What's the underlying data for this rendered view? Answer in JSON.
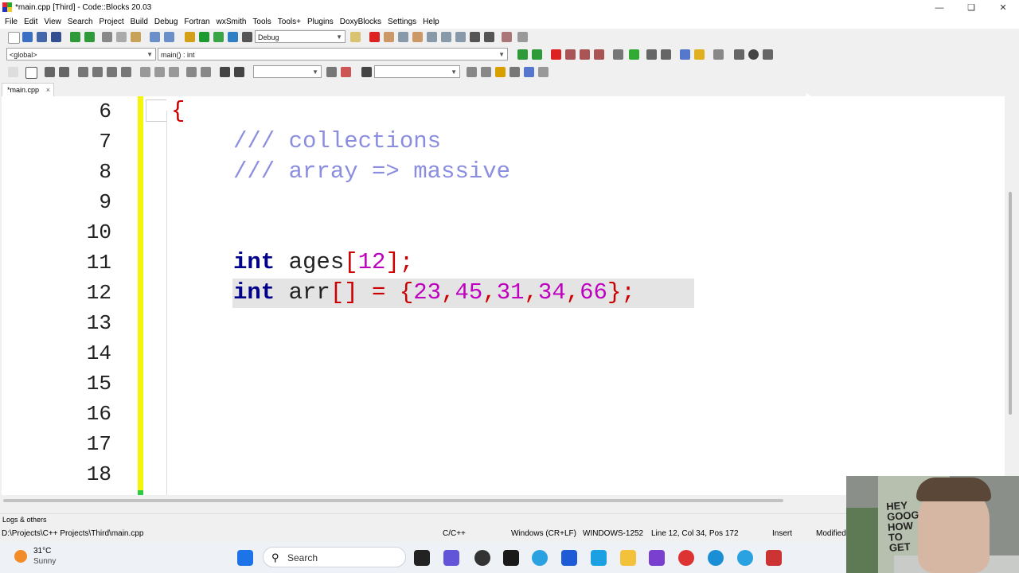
{
  "window": {
    "title": "*main.cpp [Third] - Code::Blocks 20.03"
  },
  "menu": [
    "File",
    "Edit",
    "View",
    "Search",
    "Project",
    "Build",
    "Debug",
    "Fortran",
    "wxSmith",
    "Tools",
    "Tools+",
    "Plugins",
    "DoxyBlocks",
    "Settings",
    "Help"
  ],
  "toolbar": {
    "build_target": "Debug",
    "scope": "<global>",
    "symbol": "main() : int"
  },
  "tab": {
    "label": "*main.cpp",
    "close": "×"
  },
  "editor": {
    "line_numbers": [
      "6",
      "7",
      "8",
      "9",
      "10",
      "11",
      "12",
      "13",
      "14",
      "15",
      "16",
      "17",
      "18"
    ],
    "lines": {
      "l6_brace": "{",
      "l7_comment": "/// collections",
      "l8_comment": "/// array => massive",
      "l11_kw": "int",
      "l11_id": "ages",
      "l11_open": "[",
      "l11_num": "12",
      "l11_close": "];",
      "l12_kw": "int",
      "l12_id": "arr",
      "l12_brackets": "[] = {",
      "l12_n1": "23",
      "l12_c1": ",",
      "l12_n2": "45",
      "l12_c2": ",",
      "l12_n3": "31",
      "l12_c3": ",",
      "l12_n4": "34",
      "l12_c4": ",",
      "l12_n5": "66",
      "l12_end": "};"
    }
  },
  "logs_label": "Logs & others",
  "status": {
    "path": "D:\\Projects\\C++ Projects\\Third\\main.cpp",
    "language": "C/C++",
    "eol": "Windows (CR+LF)",
    "encoding": "WINDOWS-1252",
    "position": "Line 12, Col 34, Pos 172",
    "mode": "Insert",
    "modified": "Modified"
  },
  "taskbar": {
    "temperature": "31°C",
    "condition": "Sunny",
    "search": "Search"
  },
  "webcam": {
    "sign": "HEY\nGOOGLE\nHOW\nTO\nGET"
  },
  "colors": {
    "keyword": "#00008b",
    "comment": "#8b8ee0",
    "number": "#c000c0",
    "bracket": "#cc0000",
    "change_bar": "#f5f50a"
  }
}
